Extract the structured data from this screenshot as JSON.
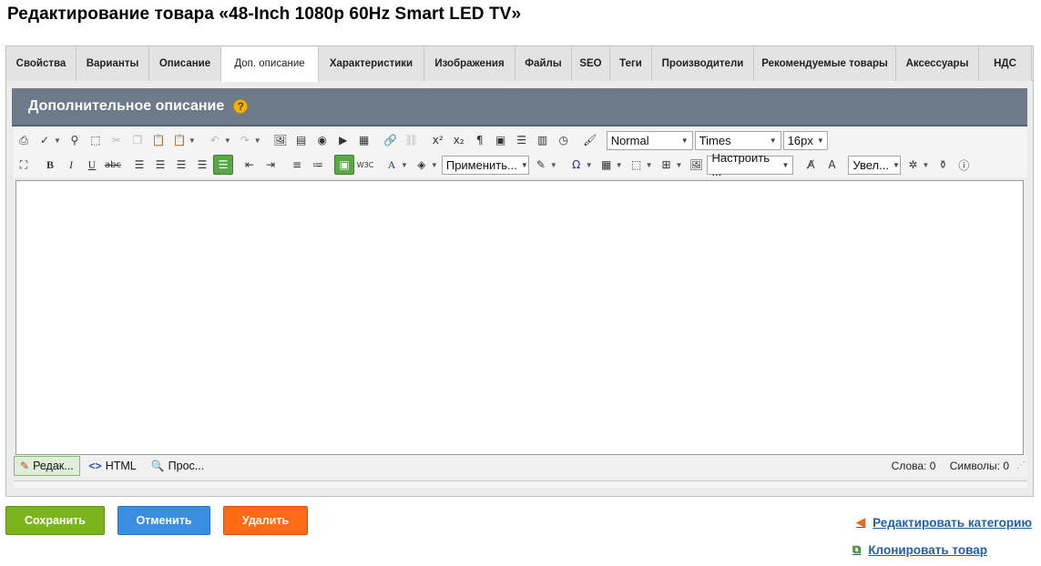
{
  "page": {
    "title": "Редактирование товара «48-Inch 1080p 60Hz Smart LED TV»"
  },
  "tabs": [
    {
      "label": "Свойства",
      "active": false
    },
    {
      "label": "Варианты",
      "active": false
    },
    {
      "label": "Описание",
      "active": false
    },
    {
      "label": "Доп. описание",
      "active": true
    },
    {
      "label": "Характеристики",
      "active": false
    },
    {
      "label": "Изображения",
      "active": false
    },
    {
      "label": "Файлы",
      "active": false
    },
    {
      "label": "SEO",
      "active": false
    },
    {
      "label": "Теги",
      "active": false
    },
    {
      "label": "Производители",
      "active": false
    },
    {
      "label": "Рекомендуемые товары",
      "active": false
    },
    {
      "label": "Аксессуары",
      "active": false
    },
    {
      "label": "НДС",
      "active": false
    }
  ],
  "section": {
    "title": "Дополнительное описание",
    "help_glyph": "?"
  },
  "toolbar": {
    "row1": {
      "format_select": "Normal",
      "font_select": "Times",
      "size_select": "16px"
    },
    "row2": {
      "apply_select": "Применить...",
      "configure_select": "Настроить ...",
      "zoom_select": "Увел..."
    }
  },
  "status": {
    "modes": [
      {
        "label": "Редак...",
        "active": true,
        "icon": "pencil-icon"
      },
      {
        "label": "HTML",
        "active": false,
        "icon": "code-icon"
      },
      {
        "label": "Прос...",
        "active": false,
        "icon": "preview-icon"
      }
    ],
    "words_label": "Слова: 0",
    "chars_label": "Символы: 0"
  },
  "actions": {
    "save": "Сохранить",
    "cancel": "Отменить",
    "delete": "Удалить"
  },
  "links": {
    "edit_category": "Редактировать категорию",
    "clone_product": "Клонировать товар"
  },
  "colors": {
    "header_bg": "#6c7a8a",
    "save": "#7ab51d",
    "cancel": "#3a8ee0",
    "delete": "#ff6a13",
    "link": "#1f5fa8"
  }
}
